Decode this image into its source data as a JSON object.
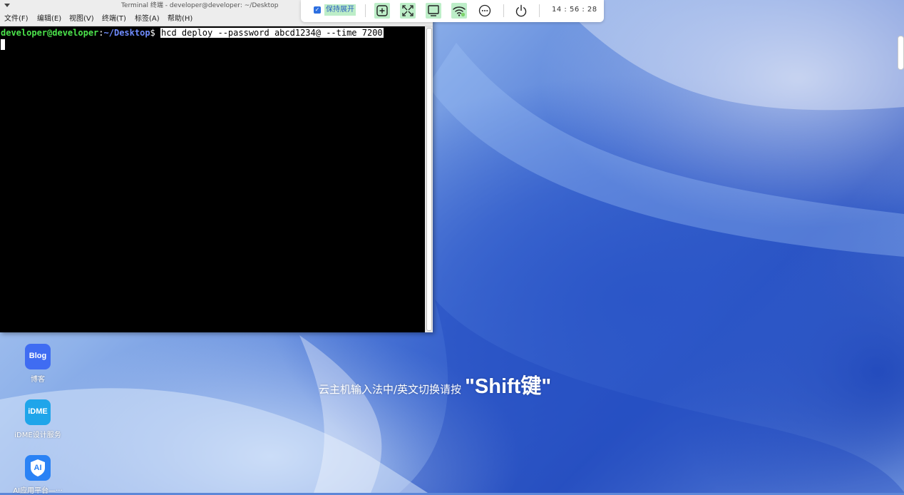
{
  "terminal": {
    "title": "Terminal 终端 - developer@developer: ~/Desktop",
    "menu": [
      "文件(F)",
      "编辑(E)",
      "视图(V)",
      "终端(T)",
      "标签(A)",
      "帮助(H)"
    ],
    "prompt_user": "developer@developer",
    "prompt_sep": ":",
    "prompt_path": "~/Desktop",
    "prompt_symbol": "$ ",
    "command": "hcd deploy --password abcd1234@ --time 7200"
  },
  "toolbar": {
    "keep_label": "保持展开",
    "keep_checked_glyph": "✓",
    "icons": [
      "add-window-icon",
      "fullscreen-icon",
      "monitor-icon",
      "wifi-icon",
      "more-icon",
      "power-icon"
    ],
    "time": "14 : 56 : 28",
    "accent": "#2d6fe0",
    "highlight": "#bdeec8"
  },
  "desktop": {
    "icons": [
      {
        "tile_text": "Blog",
        "label": "博客",
        "color": "#3f6cf2"
      },
      {
        "tile_text": "iDME",
        "label": "iDME设计服务",
        "color": "#1fa5ea"
      },
      {
        "tile_text": "AI",
        "label": "AI应用平台—···",
        "color": "#2a82f5"
      }
    ]
  },
  "ime_hint": {
    "text": "云主机输入法中/英文切换请按",
    "key": "\"Shift键\""
  }
}
